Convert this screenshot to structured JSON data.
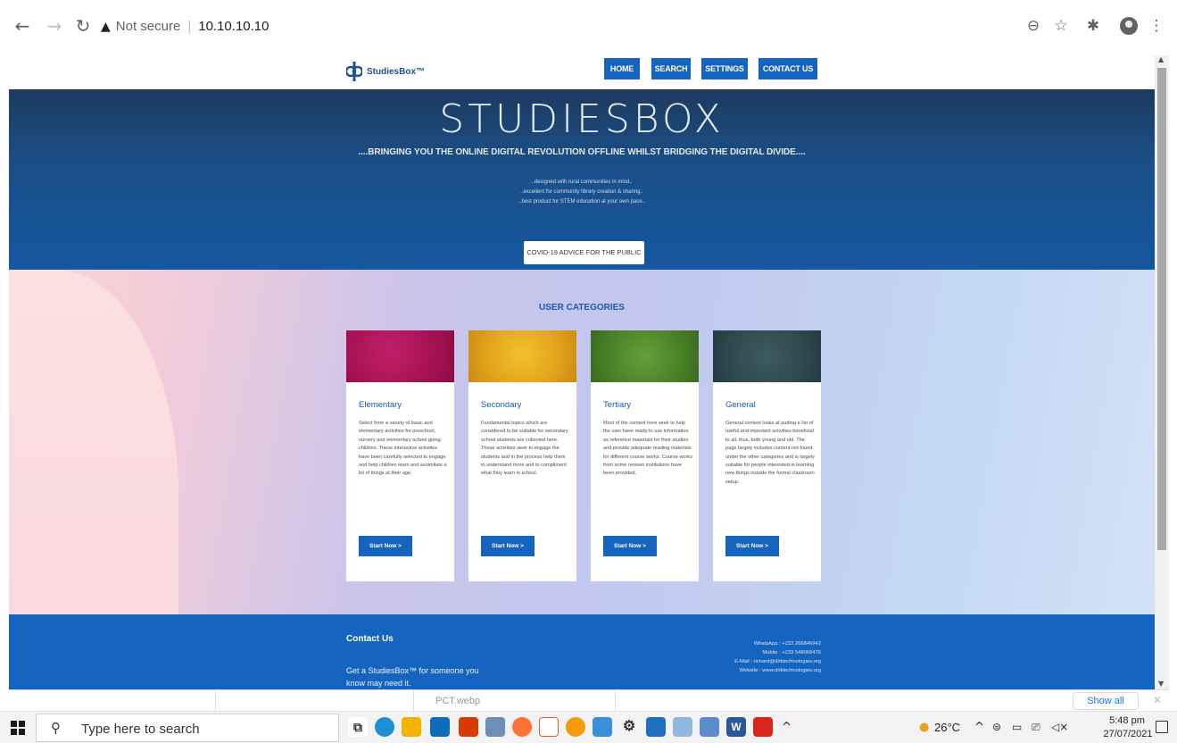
{
  "browser": {
    "security_label": "Not secure",
    "url": "10.10.10.10"
  },
  "site": {
    "logo_text": "StudiesBox™",
    "nav": [
      "HOME",
      "SEARCH",
      "SETTINGS",
      "CONTACT US"
    ]
  },
  "hero": {
    "title": "STUDIESBOX",
    "tagline": "....BRINGING YOU THE ONLINE DIGITAL REVOLUTION OFFLINE WHILST BRIDGING THE DIGITAL DIVIDE....",
    "lines": [
      "..designed with rural communities in mind..",
      "..excellent for community library creation & sharing..",
      "..best product for STEM education at your own pace.."
    ],
    "covid_button": "COVID-19 ADVICE FOR THE PUBLIC"
  },
  "categories": {
    "heading": "USER CATEGORIES",
    "cards": [
      {
        "title": "Elementary",
        "text": "Select from a variety of basic and elementary activities for preschool, nursery and elementary school going children. These interactive activities have been carefully selected to engage and help children learn and assimilate a lot of things at their age.",
        "button": "Start Now >",
        "image_color": "#b0135a"
      },
      {
        "title": "Secondary",
        "text": "Fundamental topics which are considered to be suitable for secondary school students are collected here. These activities seek to engage the students and in the process help them to understand more and to compliment what they learn in school.",
        "button": "Start Now >",
        "image_color": "#e8a71e"
      },
      {
        "title": "Tertiary",
        "text": "Most of the content here seek to help the user have ready to use information as reference materials for their studies and provide adequate reading materials for different course works. Course works from some renown institutions have been provided.",
        "button": "Start Now >",
        "image_color": "#4f8a2b"
      },
      {
        "title": "General",
        "text": "General content looks at putting a list of useful and important activities beneficial to all, thus, both young and old. The page largely includes content not found under the other categories and is largely suitable for people interested in learning new things outside the formal classroom setup.",
        "button": "Start Now >",
        "image_color": "#2f4a4f"
      }
    ]
  },
  "footer": {
    "contact_heading": "Contact Us",
    "promo": "Get a StudiesBox™ for someone you know may need it.",
    "contact_lines": [
      "WhatsApp : +233 266846942",
      "Mobile : +233 548066476",
      "E-Mail : richard@driktechnologies.org",
      "Website : www.driktechnologies.org"
    ]
  },
  "downloads": {
    "item_label": "PCT.webp",
    "show_all": "Show all"
  },
  "taskbar": {
    "search_placeholder": "Type here to search",
    "weather": "26°C",
    "time": "5:48 pm",
    "date": "27/07/2021"
  }
}
